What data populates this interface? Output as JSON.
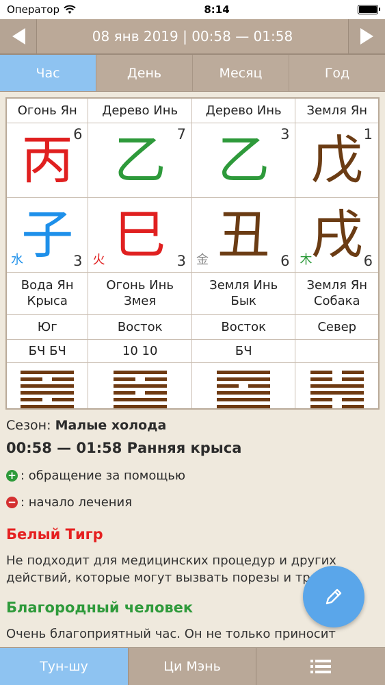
{
  "status": {
    "carrier": "Оператор",
    "time": "8:14"
  },
  "nav": {
    "date_text": "08 янв 2019  |  00:58 — 01:58",
    "prev_icon": "arrow-left-icon",
    "next_icon": "arrow-right-icon"
  },
  "tabs": [
    "Час",
    "День",
    "Месяц",
    "Год"
  ],
  "active_tab": 0,
  "pillars": [
    {
      "stem_element": "Огонь Ян",
      "stem_char": "丙",
      "stem_color": "#e02020",
      "stem_num": "6",
      "branch_char": "子",
      "branch_color": "#1e90ea",
      "branch_el": "水",
      "branch_el_color": "#1e90ea",
      "branch_num": "3",
      "desc1": "Вода Ян",
      "desc2": "Крыса",
      "direction": "Юг",
      "code": "БЧ БЧ",
      "hex": [
        1,
        0,
        1,
        1,
        0,
        1
      ]
    },
    {
      "stem_element": "Дерево Инь",
      "stem_char": "乙",
      "stem_color": "#2e9a3b",
      "stem_num": "7",
      "branch_char": "巳",
      "branch_color": "#e02020",
      "branch_el": "火",
      "branch_el_color": "#e02020",
      "branch_num": "3",
      "desc1": "Огонь Инь",
      "desc2": "Змея",
      "direction": "Восток",
      "code": "10 10",
      "hex": [
        1,
        0,
        1,
        0,
        1,
        1
      ]
    },
    {
      "stem_element": "Дерево Инь",
      "stem_char": "乙",
      "stem_color": "#2e9a3b",
      "stem_num": "3",
      "branch_char": "丑",
      "branch_color": "#6b3c14",
      "branch_el": "金",
      "branch_el_color": "#8a8a8a",
      "branch_num": "6",
      "desc1": "Земля Инь",
      "desc2": "Бык",
      "direction": "Восток",
      "code": "БЧ",
      "hex": [
        1,
        1,
        0,
        1,
        1,
        1
      ]
    },
    {
      "stem_element": "Земля Ян",
      "stem_char": "戊",
      "stem_color": "#6b3c14",
      "stem_num": "1",
      "branch_char": "戌",
      "branch_color": "#6b3c14",
      "branch_el": "木",
      "branch_el_color": "#2e9a3b",
      "branch_num": "6",
      "desc1": "Земля Ян",
      "desc2": "Собака",
      "direction": "Север",
      "code": "",
      "hex": [
        0,
        0,
        1,
        1,
        0,
        0
      ]
    }
  ],
  "season": {
    "label": "Сезон:",
    "value": "Малые холода"
  },
  "hour_title": "00:58 — 01:58 Ранняя крыса",
  "good": ": обращение за помощью",
  "bad": ": начало лечения",
  "section1": {
    "title": "Белый Тигр",
    "text": "Не подходит для медицинских процедур и других действий, которые могут вызвать порезы и травмы."
  },
  "section2": {
    "title": "Благородный человек",
    "text": "Очень благоприятный час. Он не только приносит"
  },
  "bottom": {
    "tab1": "Тун-шу",
    "tab2": "Ци Мэнь",
    "menu_icon": "list-icon",
    "fab_icon": "pencil-icon"
  }
}
